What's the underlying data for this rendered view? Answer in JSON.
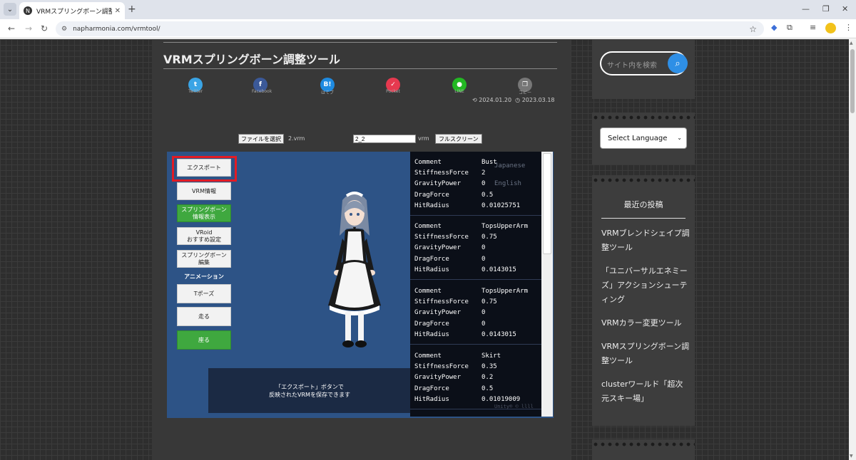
{
  "browser": {
    "tab_title": "VRMスプリングボーン調整ツール | N",
    "favicon": "N",
    "url": "napharmonia.com/vrmtool/"
  },
  "page": {
    "title": "VRMスプリングボーン調整ツール",
    "share": [
      {
        "label": "Twitter",
        "icon": "twitter-icon",
        "color": "#3aa4e5"
      },
      {
        "label": "Facebook",
        "icon": "facebook-icon",
        "color": "#3b5998"
      },
      {
        "label": "はてブ",
        "icon": "hatena-icon",
        "color": "#1e8ae0",
        "glyph": "B!"
      },
      {
        "label": "Pocket",
        "icon": "pocket-icon",
        "color": "#e6394f"
      },
      {
        "label": "LINE",
        "icon": "line-icon",
        "color": "#23b823"
      },
      {
        "label": "コピー",
        "icon": "copy-icon",
        "color": "#777777"
      }
    ],
    "published": "2024.01.20",
    "updated": "2023.03.18"
  },
  "tool": {
    "file_button": "ファイルを選択",
    "file_name": "2.vrm",
    "name_value": "2_2",
    "ext": "vrm",
    "fullscreen_button": "フルスクリーン",
    "buttons": {
      "export": "エクスポート",
      "vrm_info": "VRM情報",
      "spring_info_1": "スプリングボーン",
      "spring_info_2": "情報表示",
      "vroid_1": "VRoid",
      "vroid_2": "おすすめ設定",
      "spring_edit_1": "スプリングボーン",
      "spring_edit_2": "編集",
      "animation_label": "アニメーション",
      "tpose": "Tポーズ",
      "run": "走る",
      "sit": "座る"
    },
    "message_1": "「エクスポート」ボタンで",
    "message_2": "反映されたVRMを保存できます",
    "lang_options": [
      "Japanese",
      "English"
    ],
    "watermark": "Unity® ©  llll",
    "spring_bones": [
      {
        "comment": "Bust",
        "stiffness": "2",
        "gravity": "0",
        "drag": "0.5",
        "radius": "0.01025751"
      },
      {
        "comment": "TopsUpperArm",
        "stiffness": "0.75",
        "gravity": "0",
        "drag": "0",
        "radius": "0.0143015"
      },
      {
        "comment": "TopsUpperArm",
        "stiffness": "0.75",
        "gravity": "0",
        "drag": "0",
        "radius": "0.0143015"
      },
      {
        "comment": "Skirt",
        "stiffness": "0.35",
        "gravity": "0.2",
        "drag": "0.5",
        "radius": "0.01019009"
      }
    ],
    "keys": {
      "comment": "Comment",
      "stiffness": "StiffnessForce",
      "gravity": "GravityPower",
      "drag": "DragForce",
      "radius": "HitRadius"
    }
  },
  "sidebar": {
    "search_placeholder": "サイト内を検索",
    "language_select": "Select Language",
    "recent_title": "最近の投稿",
    "recent_posts": [
      "VRMブレンドシェイプ調整ツール",
      "「ユニバーサルエネミーズ」アクションシューティング",
      "VRMカラー変更ツール",
      "VRMスプリングボーン調整ツール",
      "clusterワールド「超次元スキー場」"
    ]
  }
}
